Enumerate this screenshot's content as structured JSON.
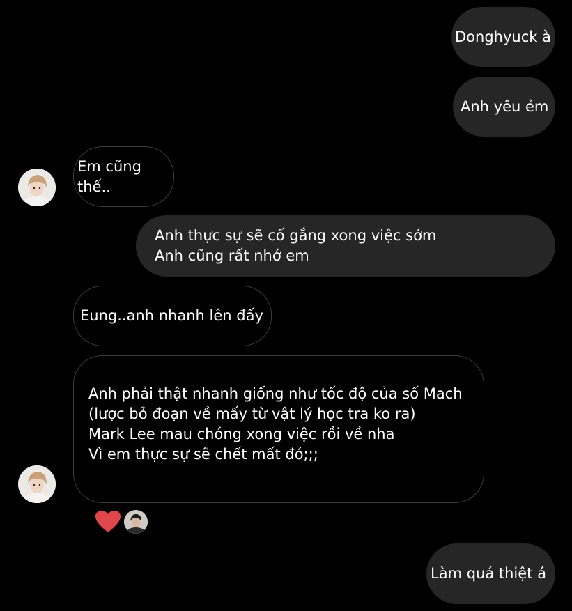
{
  "conversation": {
    "messages": [
      {
        "sender": "me",
        "text": "Donghyuck à"
      },
      {
        "sender": "me",
        "text": "Anh yêu ẻm"
      },
      {
        "sender": "them",
        "text": "Em cũng thế.."
      },
      {
        "sender": "me",
        "text": "Anh thực sự sẽ cố gắng xong việc sớm\nAnh cũng rất nhớ em"
      },
      {
        "sender": "them",
        "text": "Eung..anh nhanh lên đấy"
      },
      {
        "sender": "them",
        "text": "Anh phải thật nhanh giống như tốc độ của số Mach\n(lược bỏ đoạn về mấy từ vật lý học tra ko ra)\nMark Lee mau chóng xong việc rồi về nha\nVì em thực sự sẽ chết mất đó;;;"
      },
      {
        "sender": "me",
        "text": "Làm quá thiệt á"
      }
    ],
    "reaction": {
      "icon": "heart-icon",
      "color": "#e0474c"
    }
  },
  "colors": {
    "background": "#000000",
    "sent_bubble": "#262626",
    "received_border": "#3c3c3c",
    "text": "#ffffff"
  }
}
